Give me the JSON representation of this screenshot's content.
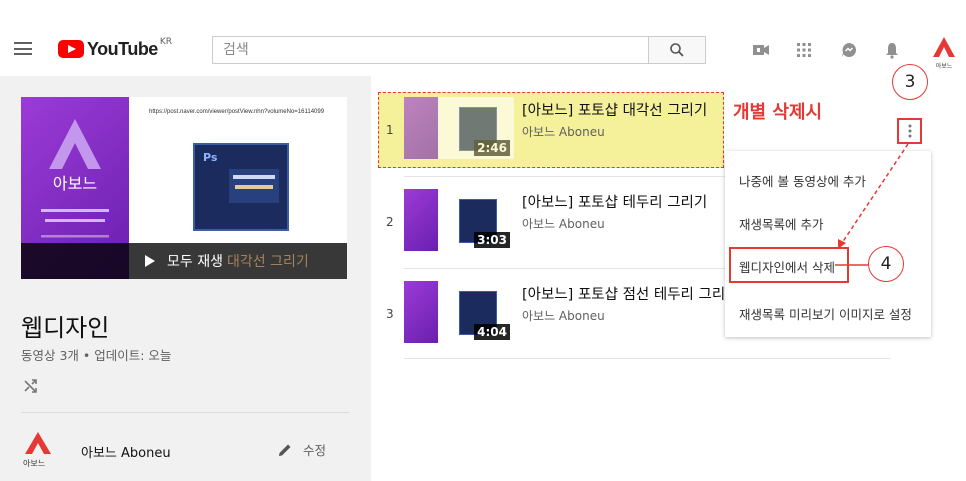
{
  "header": {
    "logo_word": "YouTube",
    "logo_region": "KR",
    "search_placeholder": "검색",
    "icons": [
      "menu-icon",
      "video-camera-icon",
      "apps-grid-icon",
      "messages-icon",
      "bell-icon",
      "avatar-icon"
    ],
    "avatar_label": "아보느"
  },
  "playlist": {
    "thumb_url_text": "https://post.naver.com/viewer/postView.nhn?volumeNo=16114099",
    "play_all": "모두 재생",
    "thumb_subtitle": "대각선 그리기",
    "title": "웹디자인",
    "meta": "동영상 3개 • 업데이트: 오늘",
    "channel_name": "아보느 Aboneu",
    "channel_logo_label": "아보느",
    "edit_label": "수정"
  },
  "videos": [
    {
      "index": "1",
      "title": "[아보느] 포토샵 대각선 그리기",
      "channel": "아보느 Aboneu",
      "duration": "2:46"
    },
    {
      "index": "2",
      "title": "[아보느] 포토샵 테두리 그리기",
      "channel": "아보느 Aboneu",
      "duration": "3:03"
    },
    {
      "index": "3",
      "title": "[아보느] 포토샵 점선 테두리 그리기",
      "channel": "아보느 Aboneu",
      "duration": "4:04"
    }
  ],
  "annotation": {
    "label": "개별 삭제시",
    "step_three": "3",
    "step_four": "4",
    "color": "#e53935"
  },
  "context_menu": {
    "items": [
      "나중에 볼 동영상에 추가",
      "재생목록에 추가",
      "웹디자인에서 삭제",
      "재생목록 미리보기 이미지로 설정"
    ]
  },
  "colors": {
    "youtube_red": "#ff0000",
    "highlight_yellow": "#f5f09a",
    "brand_purple": "#8a2fd0"
  }
}
